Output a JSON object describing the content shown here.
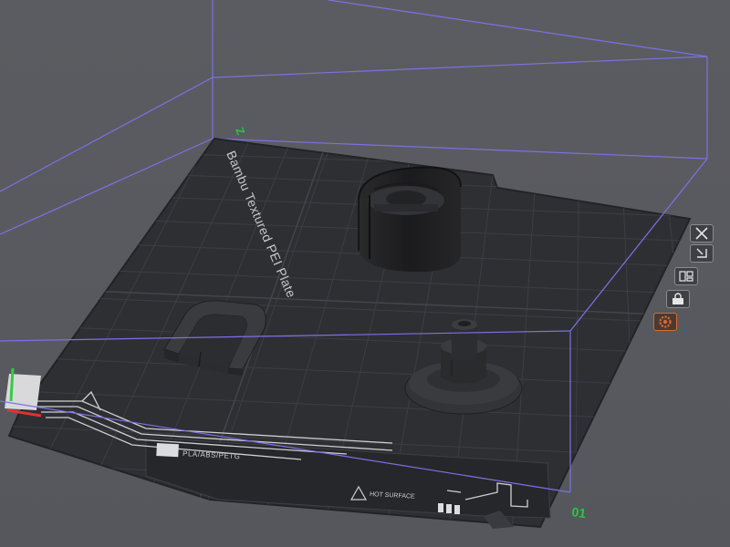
{
  "viewport": {
    "plate_title": "Bambu Textured PEI Plate",
    "plate_number": "01",
    "axis_label": "Z",
    "material_label": "PLA/ABS/PETG",
    "hot_surface_label": "HOT SURFACE"
  },
  "plate_toolbar": {
    "buttons": [
      {
        "name": "close-plate-button",
        "icon": "close-icon"
      },
      {
        "name": "select-plate-button",
        "icon": "select-icon"
      },
      {
        "name": "arrange-plate-button",
        "icon": "arrange-icon"
      },
      {
        "name": "lock-plate-button",
        "icon": "lock-icon"
      },
      {
        "name": "plate-settings-button",
        "icon": "gear-icon"
      }
    ]
  },
  "colors": {
    "background": "#5a5b60",
    "plate": "#2f3034",
    "grid": "#3b3c41",
    "bounding_box": "#7b71e6",
    "plate_number": "#22cc44",
    "accent": "#d96a2c"
  }
}
